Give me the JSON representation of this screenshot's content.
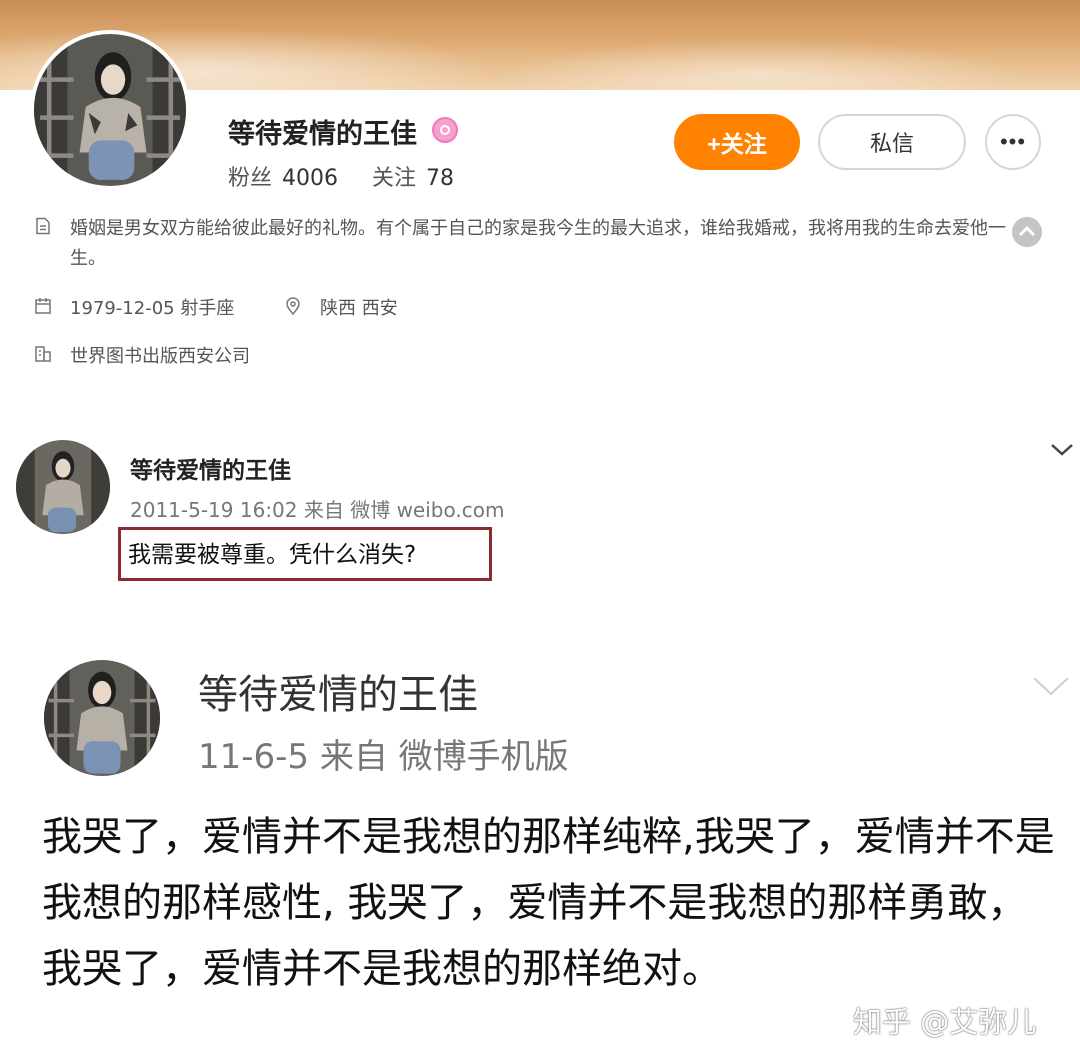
{
  "profile": {
    "name": "等待爱情的王佳",
    "followers_label": "粉丝",
    "followers_count": "4006",
    "following_label": "关注",
    "following_count": "78",
    "follow_button": "+关注",
    "message_button": "私信",
    "more_button": "•••",
    "bio": "婚姻是男女双方能给彼此最好的礼物。有个属于自己的家是我今生的最大追求，谁给我婚戒，我将用我的生命去爱他一生。",
    "birthday": "1979-12-05 射手座",
    "location": "陕西 西安",
    "company": "世界图书出版西安公司"
  },
  "post1": {
    "author": "等待爱情的王佳",
    "meta": "2011-5-19 16:02 来自 微博 weibo.com",
    "text": "我需要被尊重。凭什么消失?"
  },
  "post2": {
    "author": "等待爱情的王佳",
    "meta": "11-6-5  来自 微博手机版",
    "text": "我哭了，爱情并不是我想的那样纯粹,我哭了，爱情并不是我想的那样感性, 我哭了，爱情并不是我想的那样勇敢，  我哭了，爱情并不是我想的那样绝对。"
  },
  "watermark": "知乎 @艾弥儿",
  "colors": {
    "follow_button": "#ff8200",
    "highlight_box": "#8c2a30",
    "verified_badge": "#f37ab9"
  },
  "icons": [
    "verified-icon",
    "bio-icon",
    "birthday-icon",
    "location-icon",
    "company-icon",
    "collapse-icon",
    "chevron-down-icon"
  ]
}
